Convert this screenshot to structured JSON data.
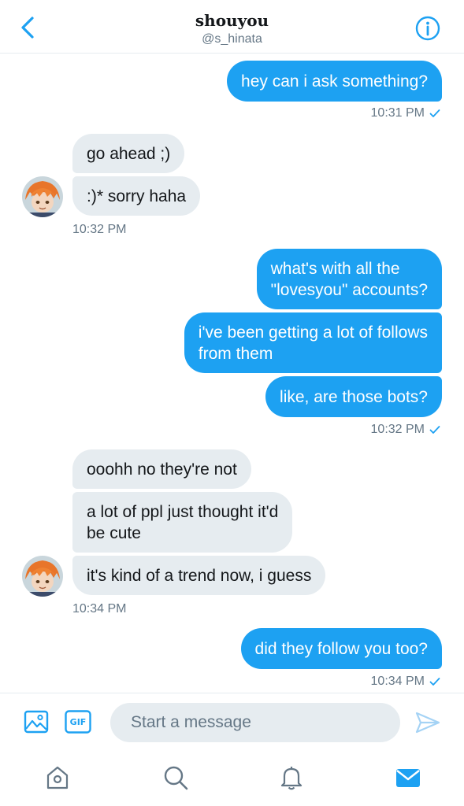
{
  "header": {
    "title": "shouyou",
    "handle": "@s_hinata"
  },
  "colors": {
    "accent": "#1da1f2",
    "received_bubble": "#e6ecf0",
    "muted_text": "#657786"
  },
  "messages": [
    {
      "text": "hey can i ask something?"
    },
    {
      "time": "10:31 PM"
    },
    {
      "text": "go ahead ;)"
    },
    {
      "text": ":)* sorry haha"
    },
    {
      "time": "10:32 PM"
    },
    {
      "text": "what's with all the\n\"lovesyou\" accounts?"
    },
    {
      "text": "i've been getting a lot of follows\nfrom them"
    },
    {
      "text": "like, are those bots?"
    },
    {
      "time": "10:32 PM"
    },
    {
      "text": "ooohh no they're not"
    },
    {
      "text": "a lot of ppl just thought it'd\nbe cute"
    },
    {
      "text": "it's kind of a trend now, i guess"
    },
    {
      "time": "10:34 PM"
    },
    {
      "text": "did they follow you too?"
    },
    {
      "time": "10:34 PM"
    }
  ],
  "composer": {
    "placeholder": "Start a message",
    "gif_label": "GIF"
  },
  "icons": {
    "back": "chevron-left-icon",
    "info": "info-icon",
    "image": "image-icon",
    "gif": "gif-icon",
    "send": "send-icon",
    "home": "home-icon",
    "search": "search-icon",
    "notifications": "bell-icon",
    "messages": "mail-icon"
  }
}
